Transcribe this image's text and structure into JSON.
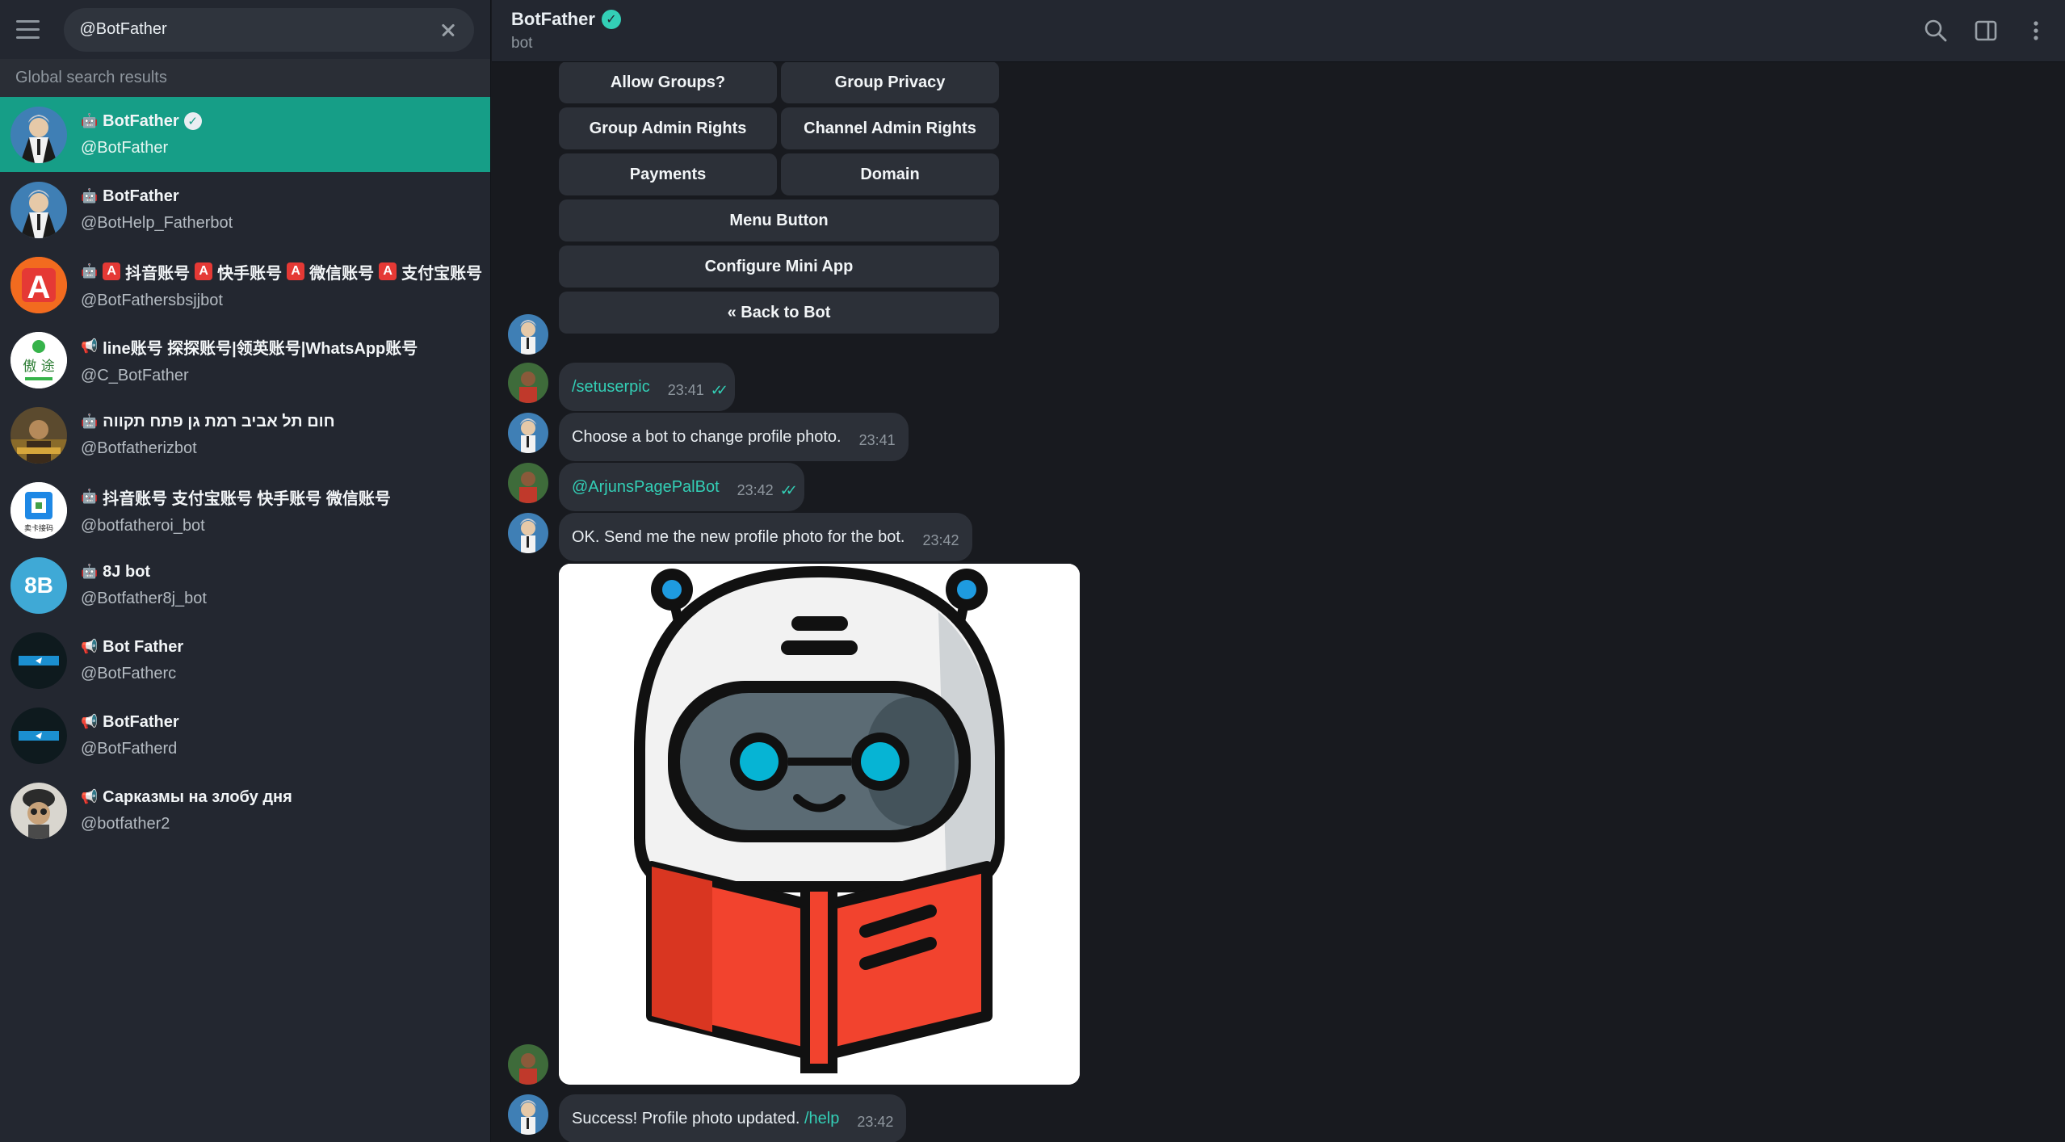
{
  "sidebar": {
    "search_value": "@BotFather",
    "section_title": "Global search results",
    "results": [
      {
        "name": "BotFather",
        "username": "@BotFather",
        "type": "bot",
        "verified": true
      },
      {
        "name": "BotFather",
        "username": "@BotHelp_Fatherbot",
        "type": "bot"
      },
      {
        "name": "抖音账号",
        "name2": "快手账号",
        "name3": "微信账号",
        "name4": "支付宝账号",
        "username": "@BotFathersbsjjbot",
        "type": "bot"
      },
      {
        "name": "line账号 探探账号|领英账号|WhatsApp账号",
        "username": "@C_BotFather",
        "type": "channel",
        "avatar_text": "傲 途"
      },
      {
        "name": "חום תל אביב רמת גן פתח תקווה",
        "username": "@Botfatherizbot",
        "type": "bot"
      },
      {
        "name": "抖音账号 支付宝账号 快手账号 微信账号",
        "username": "@botfatheroi_bot",
        "type": "bot",
        "avatar_text": "卖卡接码"
      },
      {
        "name": "8J bot",
        "username": "@Botfather8j_bot",
        "type": "bot",
        "avatar_text": "8B"
      },
      {
        "name": "Bot Father",
        "username": "@BotFatherc",
        "type": "channel"
      },
      {
        "name": "BotFather",
        "username": "@BotFatherd",
        "type": "channel"
      },
      {
        "name": "Сарказмы на злобу дня",
        "username": "@botfather2",
        "type": "channel"
      }
    ]
  },
  "header": {
    "title": "BotFather",
    "subtitle": "bot"
  },
  "keyboard": {
    "rows": [
      [
        "Allow Groups?",
        "Group Privacy"
      ],
      [
        "Group Admin Rights",
        "Channel Admin Rights"
      ],
      [
        "Payments",
        "Domain"
      ],
      [
        "Menu Button"
      ],
      [
        "Configure Mini App"
      ],
      [
        "« Back to Bot"
      ]
    ]
  },
  "messages": [
    {
      "text": "/setuserpic",
      "time": "23:41",
      "outgoing": true
    },
    {
      "text": "Choose a bot to change profile photo.",
      "time": "23:41"
    },
    {
      "text": "@ArjunsPagePalBot",
      "time": "23:42",
      "outgoing": true
    },
    {
      "text": "OK. Send me the new profile photo for the bot.",
      "time": "23:42"
    },
    {
      "text": "Success! Profile photo updated.",
      "link": "/help",
      "time": "23:42"
    }
  ],
  "colors": {
    "accent": "#169e87",
    "link": "#33cfb6",
    "background": "#181a1f",
    "panel": "#232730"
  }
}
